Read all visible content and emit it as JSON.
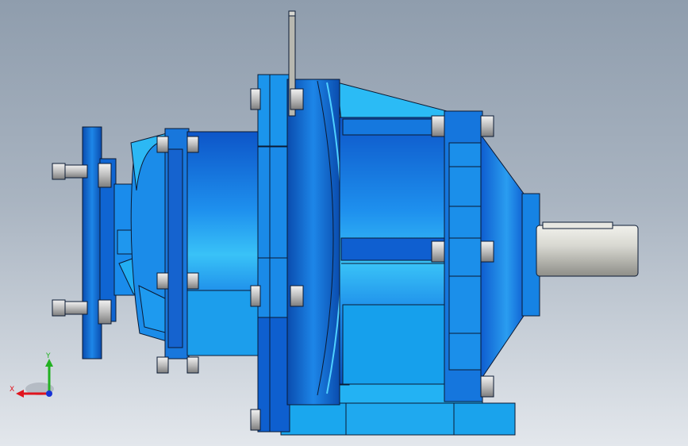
{
  "view": {
    "model_name": "",
    "colors": {
      "background_top": "#8f9dad",
      "background_bottom": "#e3e7ec",
      "housing_dark": "#0a5bd0",
      "housing_mid": "#1c7fe6",
      "housing_light": "#2fbdf6",
      "shaft": "#d9d9d4",
      "bolt": "#c8c8c8",
      "edge": "#0b1a33"
    }
  },
  "triad": {
    "x_label": "X",
    "y_label": "Y",
    "x_color": "#e0141e",
    "y_color": "#22b122",
    "z_color": "#1732d6"
  }
}
